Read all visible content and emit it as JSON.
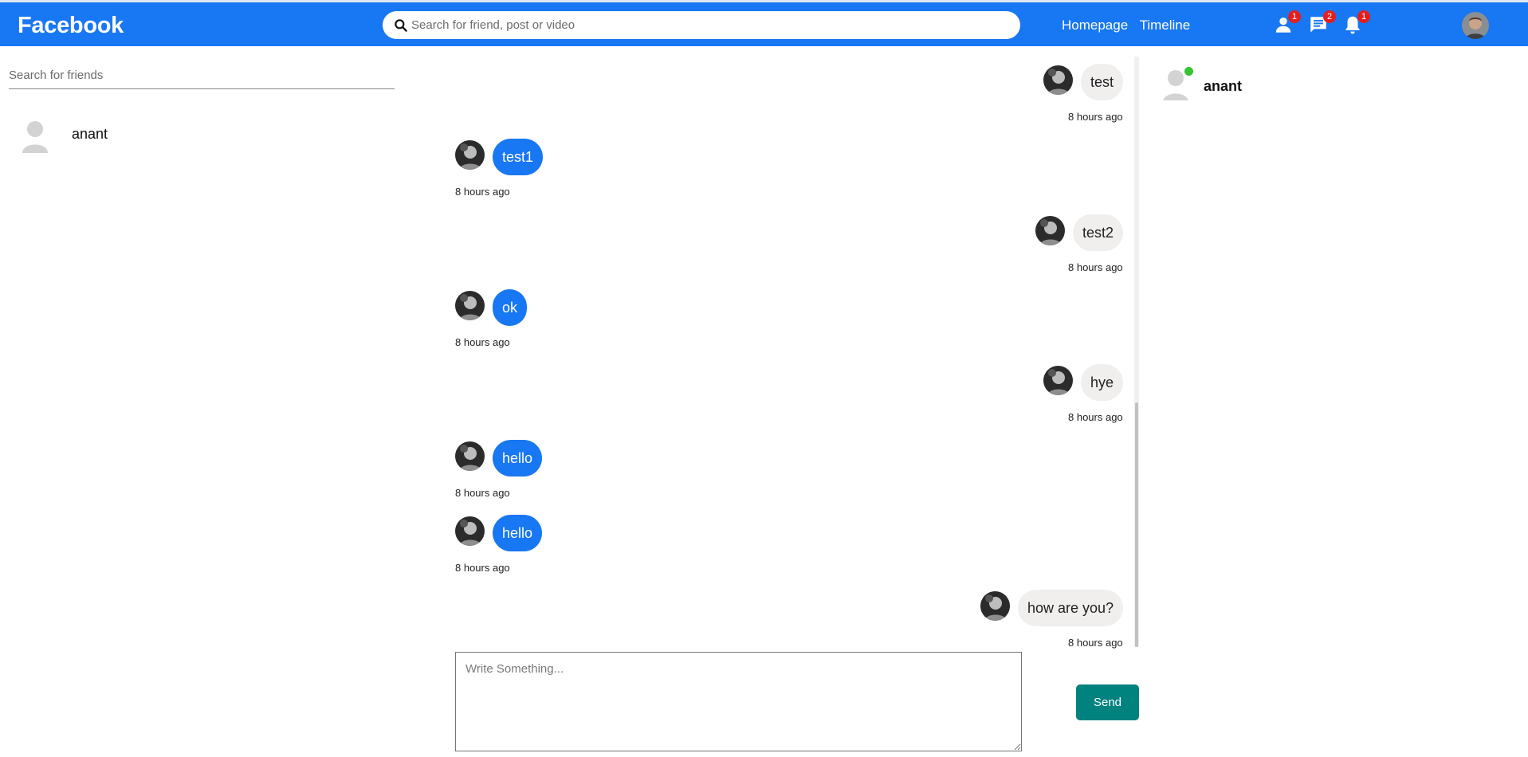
{
  "header": {
    "logo": "Facebook",
    "search_placeholder": "Search for friend, post or video",
    "links": [
      "Homepage",
      "Timeline"
    ],
    "icons": [
      {
        "name": "friend-requests-icon",
        "count": "1"
      },
      {
        "name": "messages-icon",
        "count": "2"
      },
      {
        "name": "notifications-icon",
        "count": "1"
      }
    ],
    "colors": {
      "bar": "#1877f2",
      "badge": "#e41e1e"
    }
  },
  "sidebar": {
    "search_placeholder": "Search for friends",
    "conversations": [
      {
        "name": "anant"
      }
    ]
  },
  "chat": {
    "messages": [
      {
        "text": "test",
        "time": "8 hours ago",
        "own": false
      },
      {
        "text": "test1",
        "time": "8 hours ago",
        "own": true
      },
      {
        "text": "test2",
        "time": "8 hours ago",
        "own": false
      },
      {
        "text": "ok",
        "time": "8 hours ago",
        "own": true
      },
      {
        "text": "hye",
        "time": "8 hours ago",
        "own": false
      },
      {
        "text": "hello",
        "time": "8 hours ago",
        "own": true
      },
      {
        "text": "hello",
        "time": "8 hours ago",
        "own": true
      },
      {
        "text": "how are you?",
        "time": "8 hours ago",
        "own": false
      }
    ],
    "composer_placeholder": "Write Something...",
    "send_label": "Send",
    "colors": {
      "own_bubble": "#1877f2",
      "other_bubble": "#f1eeee",
      "send_button": "#00827f"
    }
  },
  "online": {
    "friends": [
      {
        "name": "anant",
        "status_color": "#34c534"
      }
    ]
  }
}
